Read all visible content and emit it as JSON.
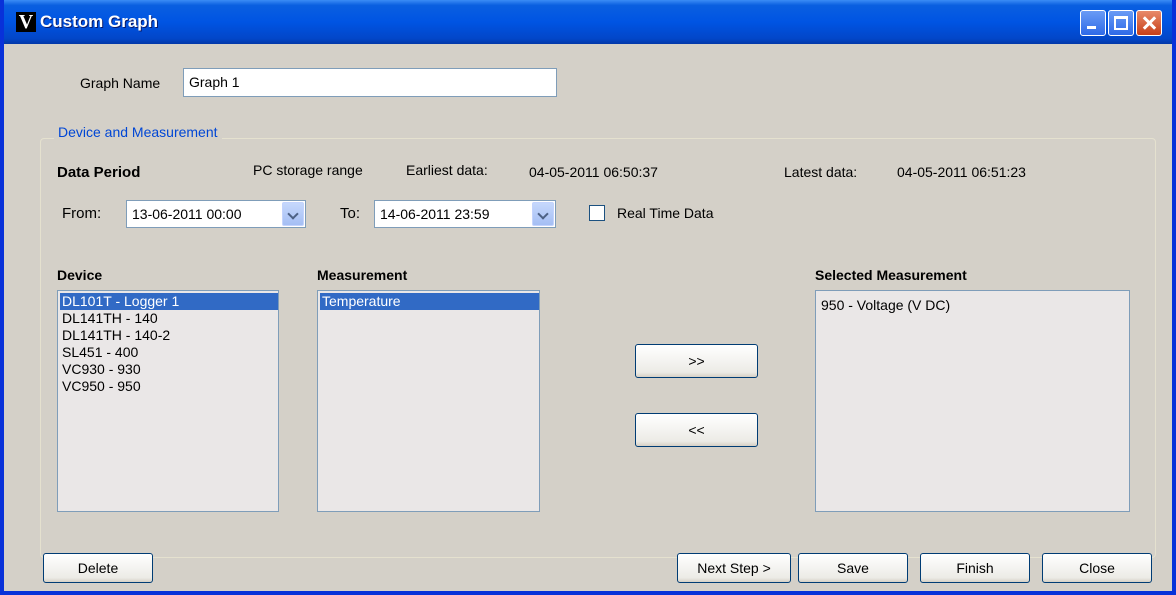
{
  "window": {
    "title": "Custom Graph",
    "icon_letter": "V"
  },
  "graph_name": {
    "label": "Graph Name",
    "value": "Graph 1"
  },
  "group": {
    "legend": "Device and Measurement"
  },
  "data_period": {
    "heading": "Data Period",
    "pc_storage_label": "PC storage range",
    "earliest_label": "Earliest data:",
    "earliest_value": "04-05-2011 06:50:37",
    "latest_label": "Latest data:",
    "latest_value": "04-05-2011 06:51:23",
    "from_label": "From:",
    "from_value": "13-06-2011 00:00",
    "to_label": "To:",
    "to_value": "14-06-2011 23:59",
    "realtime_label": "Real Time Data",
    "realtime_checked": false
  },
  "device": {
    "heading": "Device",
    "items": [
      "DL101T - Logger 1",
      "DL141TH - 140",
      "DL141TH - 140-2",
      "SL451 - 400",
      "VC930 - 930",
      "VC950 - 950"
    ],
    "selected_index": 0
  },
  "measurement": {
    "heading": "Measurement",
    "items": [
      "Temperature"
    ],
    "selected_index": 0
  },
  "selected_measurement": {
    "heading": "Selected Measurement",
    "items": [
      "950 - Voltage (V DC)"
    ]
  },
  "transfer": {
    "add_label": ">>",
    "remove_label": "<<"
  },
  "footer": {
    "delete_label": "Delete",
    "next_label": "Next Step >",
    "save_label": "Save",
    "finish_label": "Finish",
    "close_label": "Close"
  },
  "colors": {
    "titlebar": "#0054e3",
    "face": "#d4d0c8",
    "selection": "#316ac5",
    "group_legend": "#0046d5"
  },
  "icons": {
    "minimize": "minimize-icon",
    "maximize": "maximize-icon",
    "close": "close-icon",
    "dropdown": "chevron-down-icon"
  }
}
